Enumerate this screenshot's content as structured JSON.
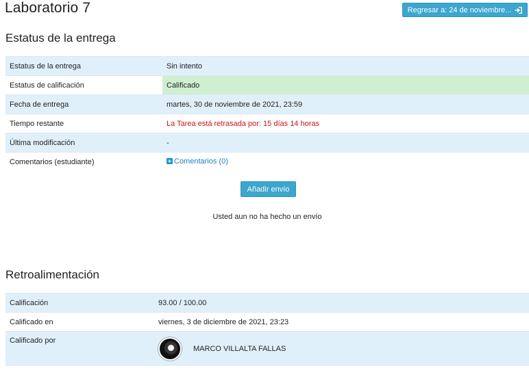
{
  "page": {
    "title": "Laboratorio 7",
    "back_button_label": "Regresar a: 24 de noviembre..."
  },
  "submission_status": {
    "heading": "Estatus de la entrega",
    "rows": [
      {
        "label": "Estatus de la entrega",
        "value": "Sin intento"
      },
      {
        "label": "Estatus de calificación",
        "value": "Calificado"
      },
      {
        "label": "Fecha de entrega",
        "value": "martes, 30 de noviembre de 2021, 23:59"
      },
      {
        "label": "Tiempo restante",
        "value": "La Tarea está retrasada por: 15 días 14 horas"
      },
      {
        "label": "Última modificación",
        "value": "-"
      },
      {
        "label": "Comentarios (estudiante)",
        "value": "Comentarios (0)"
      }
    ],
    "add_submission_label": "Añadir envío",
    "no_submission_text": "Usted aun no ha hecho un envío"
  },
  "feedback": {
    "heading": "Retroalimentación",
    "rows": [
      {
        "label": "Calificación",
        "value": "93.00 / 100.00"
      },
      {
        "label": "Calificado en",
        "value": "viernes, 3 de diciembre de 2021, 23:23"
      },
      {
        "label": "Calificado por",
        "value": "MARCO VILLALTA FALLAS"
      }
    ]
  },
  "colors": {
    "accent": "#3ca6ce",
    "row_highlight": "#e0f0fb",
    "graded_status": "#cfefd0",
    "late_text": "#d11111",
    "link": "#1f7fbf"
  },
  "icons": {
    "back_button": "sign-in-icon",
    "comments": "plus-square-icon"
  }
}
